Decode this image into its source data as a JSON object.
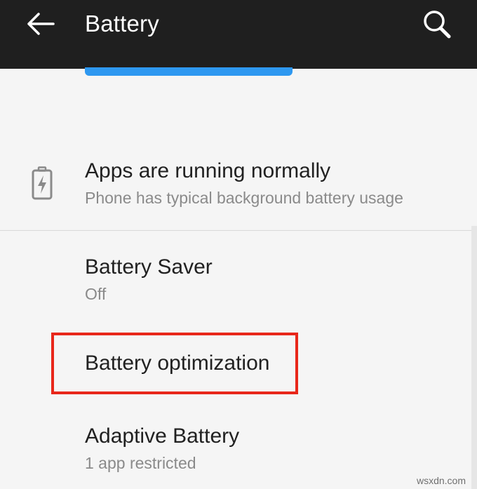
{
  "header": {
    "title": "Battery",
    "back_icon": "arrow-left-icon",
    "search_icon": "search-icon",
    "background_color": "#1f1f1f"
  },
  "accent_color": "#2e98f0",
  "status": {
    "title": "Apps are running normally",
    "subtitle": "Phone has typical background battery usage",
    "icon": "battery-charging-icon"
  },
  "items": [
    {
      "title": "Battery Saver",
      "subtitle": "Off"
    },
    {
      "title": "Battery optimization",
      "highlighted": true,
      "highlight_color": "#e8271a"
    },
    {
      "title": "Adaptive Battery",
      "subtitle": "1 app restricted"
    }
  ],
  "watermark": "wsxdn.com"
}
